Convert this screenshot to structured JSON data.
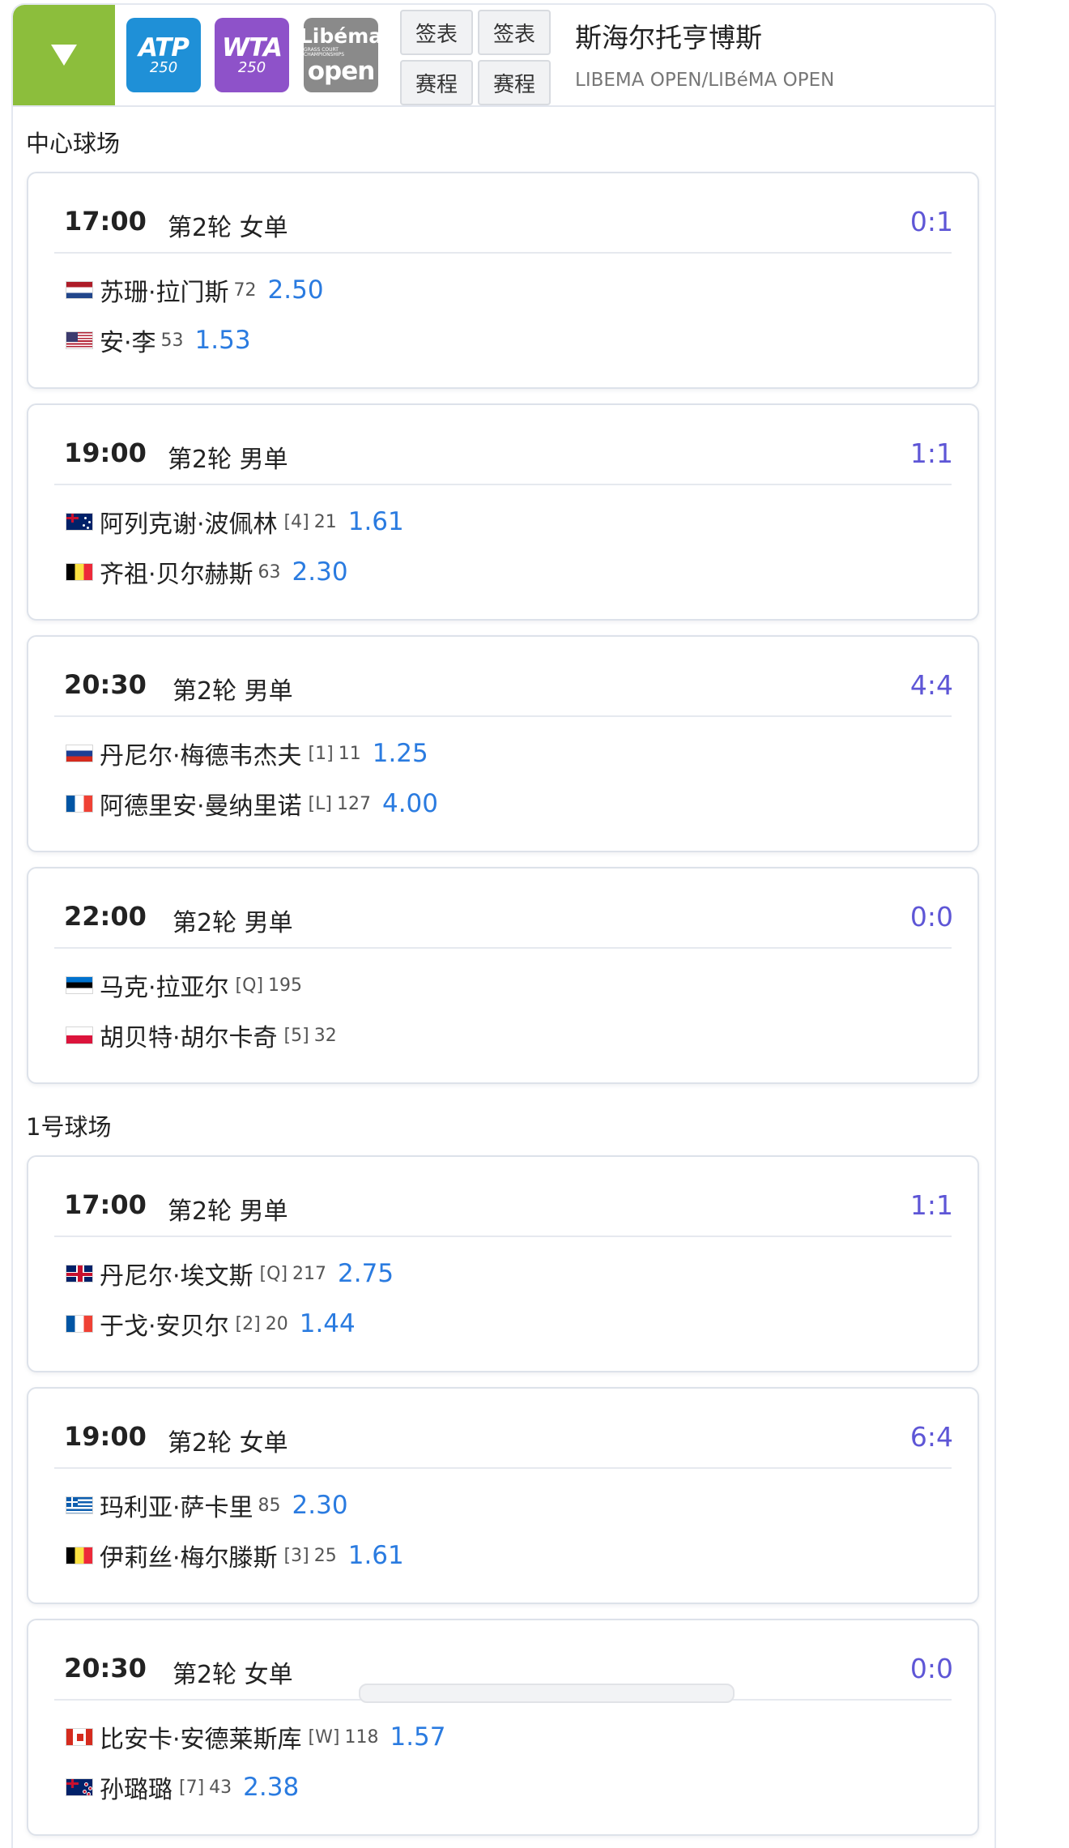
{
  "header": {
    "logos": {
      "atp": {
        "main": "ATP",
        "sub": "250"
      },
      "wta": {
        "main": "WTA",
        "sub": "250"
      },
      "libema": {
        "line1": "Libéma",
        "line2": "GRASS COURT CHAMPIONSHIPS",
        "line3": "open"
      }
    },
    "buttons": {
      "draw_atp": "签表",
      "draw_wta": "签表",
      "schedule_atp": "赛程",
      "schedule_wta": "赛程"
    },
    "tournament_name": "斯海尔托亨博斯",
    "tournament_sub": "LIBEMA OPEN/LIBéMA OPEN",
    "accent_color": "#8cbe3c"
  },
  "courts": [
    {
      "title": "中心球场",
      "matches": [
        {
          "time": "17:00",
          "round": "第2轮 女单",
          "score": "0:1",
          "p1": {
            "flag": "nl",
            "name": "苏珊·拉门斯",
            "seed": "",
            "rank": "72",
            "odds": "2.50"
          },
          "p2": {
            "flag": "us",
            "name": "安·李",
            "seed": "",
            "rank": "53",
            "odds": "1.53"
          }
        },
        {
          "time": "19:00",
          "round": "第2轮 男单",
          "score": "1:1",
          "p1": {
            "flag": "au",
            "name": "阿列克谢·波佩林",
            "seed": "[4]",
            "rank": "21",
            "odds": "1.61"
          },
          "p2": {
            "flag": "be",
            "name": "齐祖·贝尔赫斯",
            "seed": "",
            "rank": "63",
            "odds": "2.30"
          }
        },
        {
          "time": "20:30",
          "round": "第2轮 男单",
          "score": "4:4",
          "p1": {
            "flag": "ru",
            "name": "丹尼尔·梅德韦杰夫",
            "seed": "[1]",
            "rank": "11",
            "odds": "1.25"
          },
          "p2": {
            "flag": "fr",
            "name": "阿德里安·曼纳里诺",
            "seed": "[L]",
            "rank": "127",
            "odds": "4.00"
          }
        },
        {
          "time": "22:00",
          "round": "第2轮 男单",
          "score": "0:0",
          "p1": {
            "flag": "ee",
            "name": "马克·拉亚尔",
            "seed": "[Q]",
            "rank": "195",
            "odds": ""
          },
          "p2": {
            "flag": "pl",
            "name": "胡贝特·胡尔卡奇",
            "seed": "[5]",
            "rank": "32",
            "odds": ""
          }
        }
      ]
    },
    {
      "title": "1号球场",
      "matches": [
        {
          "time": "17:00",
          "round": "第2轮 男单",
          "score": "1:1",
          "p1": {
            "flag": "gb",
            "name": "丹尼尔·埃文斯",
            "seed": "[Q]",
            "rank": "217",
            "odds": "2.75"
          },
          "p2": {
            "flag": "fr",
            "name": "于戈·安贝尔",
            "seed": "[2]",
            "rank": "20",
            "odds": "1.44"
          }
        },
        {
          "time": "19:00",
          "round": "第2轮 女单",
          "score": "6:4",
          "p1": {
            "flag": "gr",
            "name": "玛利亚·萨卡里",
            "seed": "",
            "rank": "85",
            "odds": "2.30"
          },
          "p2": {
            "flag": "be",
            "name": "伊莉丝·梅尔滕斯",
            "seed": "[3]",
            "rank": "25",
            "odds": "1.61"
          }
        },
        {
          "time": "20:30",
          "round": "第2轮 女单",
          "score": "0:0",
          "p1": {
            "flag": "ca",
            "name": "比安卡·安德莱斯库",
            "seed": "[W]",
            "rank": "118",
            "odds": "1.57"
          },
          "p2": {
            "flag": "nz",
            "name": "孙璐璐",
            "seed": "[7]",
            "rank": "43",
            "odds": "2.38"
          }
        }
      ]
    }
  ],
  "colors": {
    "score": "#5e56d6",
    "odds": "#2a7be0"
  }
}
